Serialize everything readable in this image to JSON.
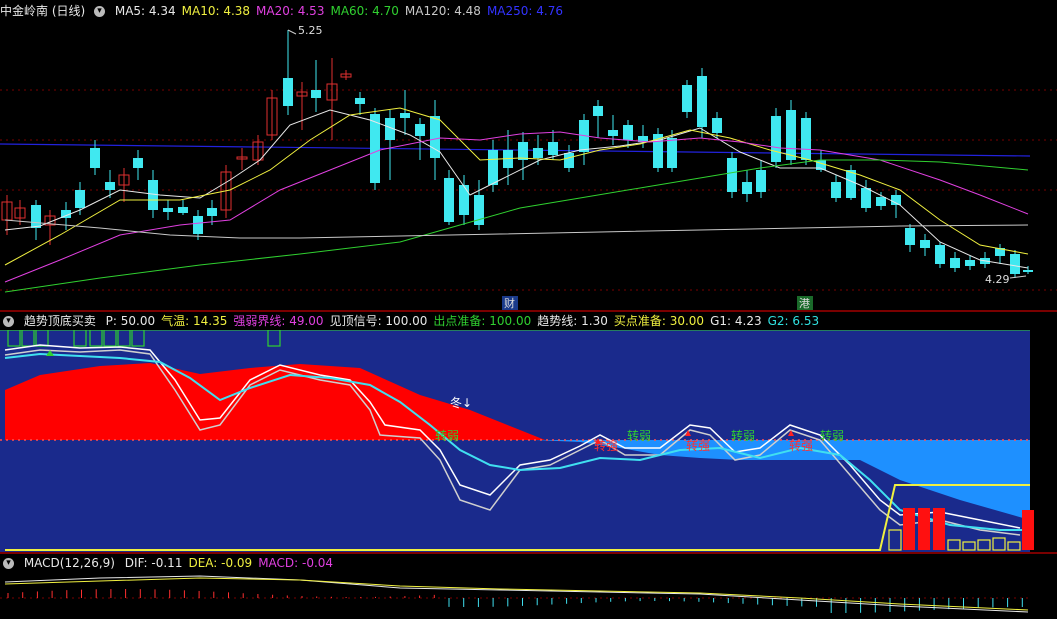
{
  "main_header": {
    "title": "中金岭南 (日线)",
    "indicators": [
      {
        "label": "MA5: 4.34",
        "color": "#e8e8e8"
      },
      {
        "label": "MA10: 4.38",
        "color": "#f0f040"
      },
      {
        "label": "MA20: 4.53",
        "color": "#e040e0"
      },
      {
        "label": "MA60: 4.70",
        "color": "#30d030"
      },
      {
        "label": "MA120: 4.48",
        "color": "#c8c8c8"
      },
      {
        "label": "MA250: 4.76",
        "color": "#3333ff"
      }
    ]
  },
  "main_annotations": {
    "high_label": "5.25",
    "low_label": "4.29",
    "marker_cai": "财",
    "marker_gang": "港"
  },
  "indicator_header": {
    "title": "趋势顶底买卖",
    "params": [
      {
        "label": "P: 50.00",
        "color": "#e8e8e8"
      },
      {
        "label": "气温: 14.35",
        "color": "#f0f040"
      },
      {
        "label": "强弱界线: 49.00",
        "color": "#e040e0"
      },
      {
        "label": "见顶信号: 100.00",
        "color": "#e8e8e8"
      },
      {
        "label": "出点准备: 100.00",
        "color": "#30d030"
      },
      {
        "label": "趋势线: 1.30",
        "color": "#e8e8e8"
      },
      {
        "label": "买点准备: 30.00",
        "color": "#f0f040"
      },
      {
        "label": "G1: 4.23",
        "color": "#e8e8e8"
      },
      {
        "label": "G2: 6.53",
        "color": "#30e0e0"
      }
    ],
    "label_winter": "冬↓",
    "label_weak": "转弱",
    "label_strong": "转强"
  },
  "macd_header": {
    "title": "MACD(12,26,9)",
    "params": [
      {
        "label": "DIF: -0.11",
        "color": "#e8e8e8"
      },
      {
        "label": "DEA: -0.09",
        "color": "#f0f040"
      },
      {
        "label": "MACD: -0.04",
        "color": "#e040e0"
      }
    ]
  },
  "colors": {
    "up": "#e03030",
    "down": "#40e8f0",
    "bg": "#000000",
    "panel_blue": "#1a2a8c",
    "sep": "#7a0000"
  }
}
